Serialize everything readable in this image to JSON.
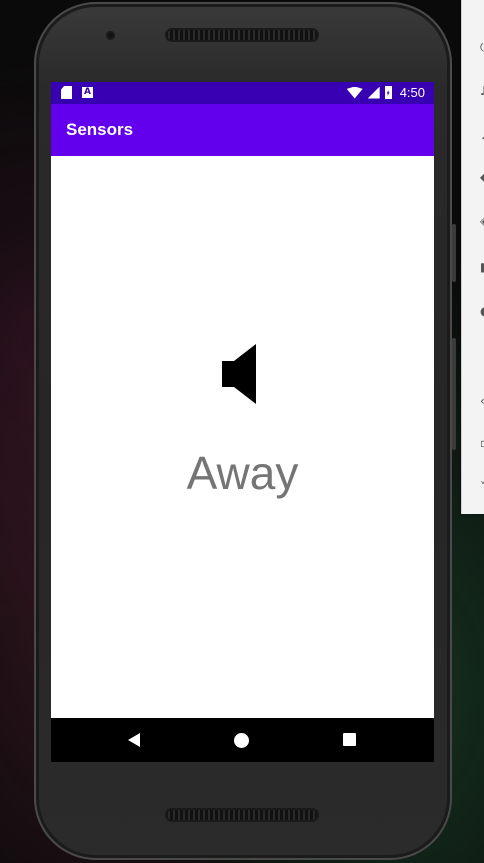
{
  "status_bar": {
    "time": "4:50",
    "color": "#3700b3",
    "icons": [
      "sd-card-icon",
      "a-notification-icon",
      "wifi-icon",
      "signal-icon",
      "battery-charging-icon"
    ]
  },
  "app_bar": {
    "title": "Sensors",
    "color": "#6200ee"
  },
  "content": {
    "icon": "speaker-muted-icon",
    "state_label": "Away"
  },
  "navigation_bar": {
    "buttons": [
      "back-icon",
      "home-icon",
      "recents-icon"
    ]
  },
  "emulator_toolbar": {
    "icons": [
      "power-icon",
      "volume-up-icon",
      "volume-down-icon",
      "rotate-left-icon",
      "rotate-right-icon",
      "camera-icon",
      "zoom-icon",
      "back-icon",
      "home-icon",
      "overview-icon"
    ]
  }
}
